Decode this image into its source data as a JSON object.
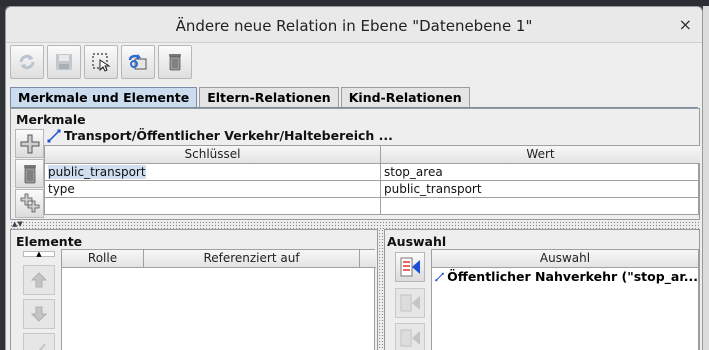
{
  "window": {
    "title": "Ändere neue Relation in Ebene \"Datenebene 1\"",
    "close_glyph": "×"
  },
  "toolbar": {
    "buttons": [
      "refresh-icon",
      "save-icon",
      "select-icon",
      "zoom-to-icon",
      "delete-icon"
    ]
  },
  "tabs": [
    {
      "label": "Merkmale und Elemente",
      "active": true
    },
    {
      "label": "Eltern-Relationen",
      "active": false
    },
    {
      "label": "Kind-Relationen",
      "active": false
    }
  ],
  "properties": {
    "section_label": "Merkmale",
    "relation_name": "Transport/Öffentlicher Verkehr/Haltebereich ...",
    "columns": {
      "key": "Schlüssel",
      "value": "Wert"
    },
    "rows": [
      {
        "key": "public_transport",
        "value": "stop_area"
      },
      {
        "key": " type",
        "value": "public_transport"
      },
      {
        "key": "",
        "value": ""
      }
    ]
  },
  "members": {
    "section_label": "Elemente",
    "columns": {
      "role": "Rolle",
      "ref": "Referenziert auf"
    }
  },
  "selection": {
    "section_label": "Auswahl",
    "column": "Auswahl",
    "items": [
      "Öffentlicher Nahverkehr (\"stop_ar..."
    ]
  },
  "colors": {
    "tab_active": "#ccdcef",
    "selected_cell": "#cfdff0",
    "relation_icon": "#1f4fd8"
  }
}
